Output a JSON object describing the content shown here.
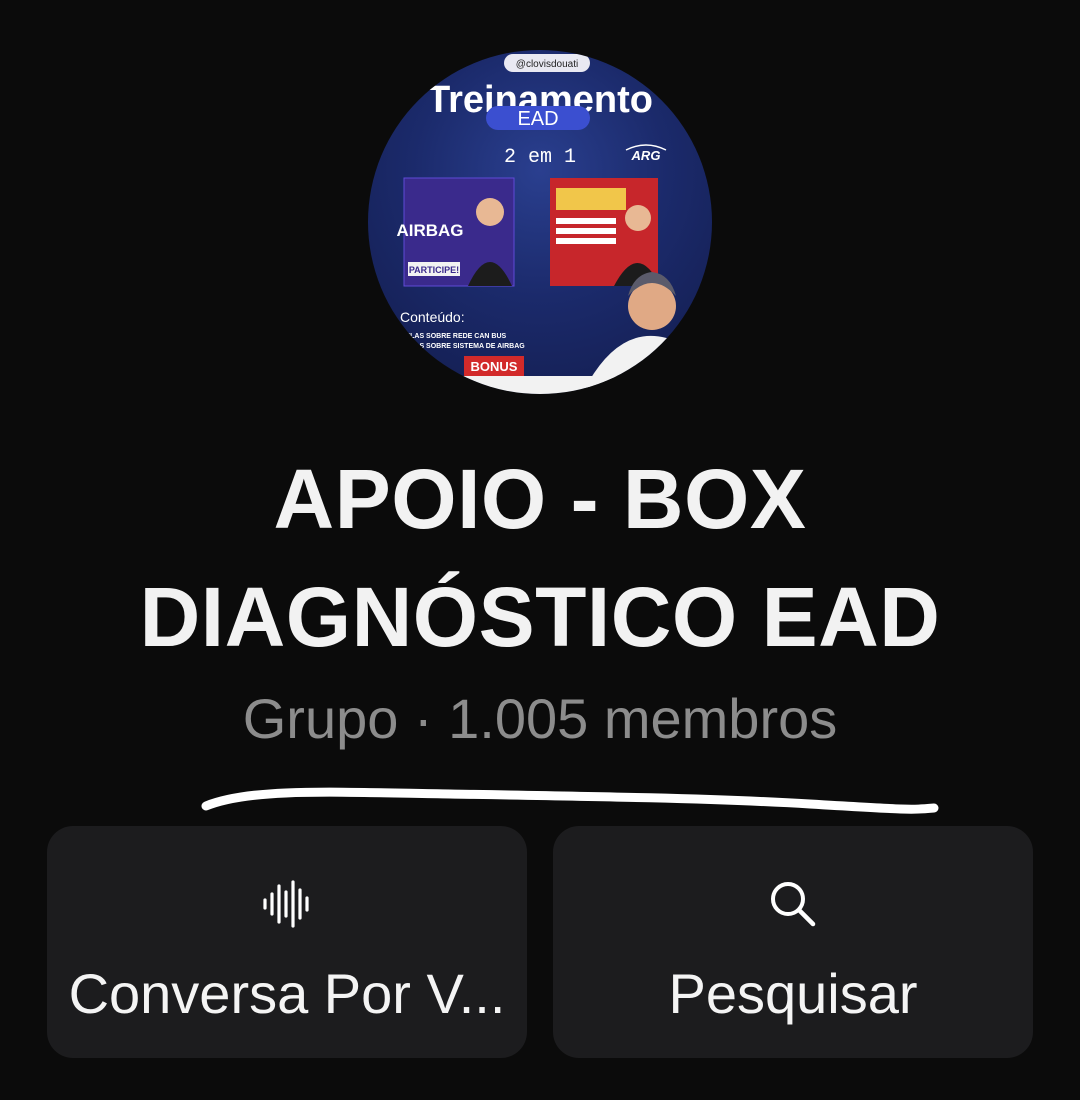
{
  "avatar": {
    "handle": "@clovisdouati",
    "headline": "Treinamento",
    "badge": "EAD",
    "tagline": "2 em 1",
    "brand": "ARG",
    "card_left_title": "AIRBAG",
    "card_left_cta": "PARTICIPE!",
    "content_heading": "Conteúdo:",
    "content_line_1": "AULAS SOBRE REDE CAN BUS",
    "content_line_2": "AULAS SOBRE SISTEMA DE AIRBAG",
    "bonus": "BONUS"
  },
  "group": {
    "title_line_1": "APOIO - BOX",
    "title_line_2": "DIAGNÓSTICO EAD",
    "subtitle": "Grupo · 1.005 membros"
  },
  "actions": {
    "voice_label": "Conversa Por V...",
    "search_label": "Pesquisar"
  },
  "colors": {
    "background": "#0b0b0b",
    "button_bg": "#1c1c1e",
    "subtitle": "#8c8c8c",
    "accent_blue": "#3b4fd0",
    "bonus_red": "#d22a2a"
  }
}
